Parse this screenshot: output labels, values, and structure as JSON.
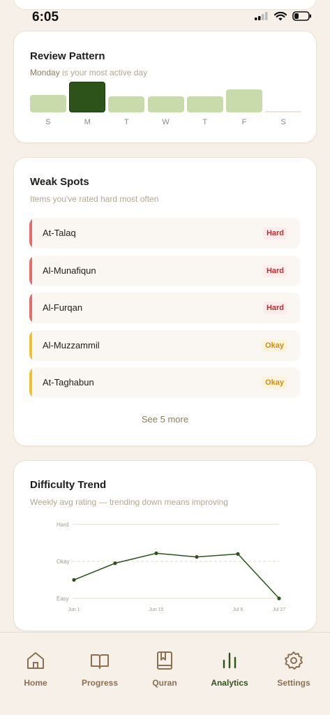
{
  "status": {
    "time": "6:05"
  },
  "review": {
    "title": "Review Pattern",
    "subtitle_highlight": "Monday",
    "subtitle_rest": " is your most active day",
    "days": [
      {
        "label": "S",
        "level": 0.55
      },
      {
        "label": "M",
        "level": 0.95,
        "active": true
      },
      {
        "label": "T",
        "level": 0.5
      },
      {
        "label": "W",
        "level": 0.5
      },
      {
        "label": "T",
        "level": 0.5
      },
      {
        "label": "F",
        "level": 0.72
      },
      {
        "label": "S",
        "level": 0
      }
    ]
  },
  "weak": {
    "title": "Weak Spots",
    "subtitle": "Items you've rated hard most often",
    "items": [
      {
        "name": "At-Talaq",
        "rating": "Hard",
        "kind": "hard"
      },
      {
        "name": "Al-Munafiqun",
        "rating": "Hard",
        "kind": "hard"
      },
      {
        "name": "Al-Furqan",
        "rating": "Hard",
        "kind": "hard"
      },
      {
        "name": "Al-Muzzammil",
        "rating": "Okay",
        "kind": "okay"
      },
      {
        "name": "At-Taghabun",
        "rating": "Okay",
        "kind": "okay"
      }
    ],
    "see_more": "See 5 more",
    "colors": {
      "hard": "#e86a6a",
      "okay": "#f2c028"
    }
  },
  "trend": {
    "title": "Difficulty Trend",
    "subtitle": "Weekly avg rating — trending down means improving"
  },
  "chart_data": {
    "type": "line",
    "yticks": [
      "Easy",
      "Okay",
      "Hard"
    ],
    "ylim": [
      1,
      3
    ],
    "xticks": [
      "Jun 1",
      "Jun 15",
      "Jul 6",
      "Jul 27"
    ],
    "x": [
      "Jun 1",
      "Jun 8",
      "Jun 15",
      "Jun 22",
      "Jul 6",
      "Jul 27"
    ],
    "values": [
      1.5,
      1.95,
      2.22,
      2.12,
      2.2,
      1.0
    ],
    "line_color": "#2d531b"
  },
  "nav": {
    "items": [
      {
        "label": "Home",
        "icon": "home-icon"
      },
      {
        "label": "Progress",
        "icon": "book-open-icon"
      },
      {
        "label": "Quran",
        "icon": "bookmark-book-icon"
      },
      {
        "label": "Analytics",
        "icon": "bar-chart-icon",
        "active": true
      },
      {
        "label": "Settings",
        "icon": "gear-icon"
      }
    ]
  }
}
